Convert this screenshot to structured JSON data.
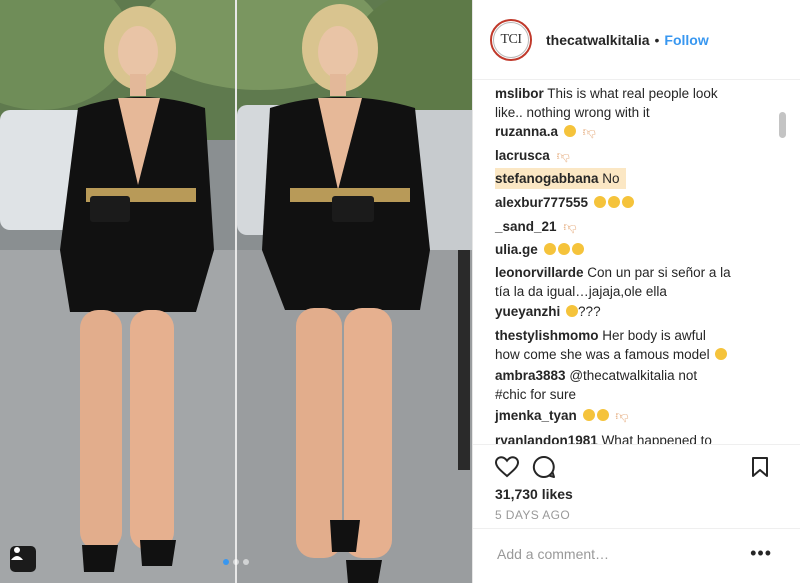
{
  "post": {
    "account_logo_text": "TCI",
    "username": "thecatwalkitalia",
    "separator": "•",
    "follow_label": "Follow",
    "likes": "31,730 likes",
    "time_ago": "5 DAYS AGO",
    "add_comment_placeholder": "Add a comment…",
    "more_label": "•••",
    "carousel": {
      "count": 3,
      "active_index": 0
    }
  },
  "comments": [
    {
      "user": "mslibor",
      "text": "This is what real people look",
      "text2": "like.. nothing wrong with it"
    },
    {
      "user": "ruzanna.a",
      "text": "",
      "emojis": [
        "smile-emoji",
        "thumbs-down-emoji"
      ]
    },
    {
      "user": "lacrusca",
      "text": "",
      "emojis": [
        "thumbs-down-emoji"
      ]
    },
    {
      "user": "stefanogabbana",
      "text": "No",
      "highlighted": true
    },
    {
      "user": "alexbur777555",
      "text": "",
      "emojis": [
        "sad-emoji",
        "sad-emoji",
        "sad-emoji"
      ]
    },
    {
      "user": "_sand_21",
      "text": "",
      "emojis": [
        "thumbs-down-emoji"
      ]
    },
    {
      "user": "ulia.ge",
      "text": "",
      "emojis": [
        "sad-emoji",
        "sad-emoji",
        "sad-emoji"
      ]
    },
    {
      "user": "leonorvillarde",
      "text": "Con un par si señor a la",
      "text2": "tía la da igual…jajaja,ole ella"
    },
    {
      "user": "yueyanzhi",
      "text": "???",
      "emojis_before": [
        "sad-emoji"
      ]
    },
    {
      "user": "thestylishmomo",
      "text": "Her body is awful",
      "text2": "how come she was a famous model"
    },
    {
      "user": "ambra3883",
      "text": "@thecatwalkitalia not",
      "text2": "#chic for sure"
    },
    {
      "user": "jmenka_tyan",
      "text": "",
      "emojis": [
        "sad-emoji",
        "sad-emoji",
        "thumbs-down-emoji"
      ]
    },
    {
      "user": "ryanlandon1981",
      "text": "What happened to"
    }
  ],
  "colors": {
    "link": "#3897f0",
    "highlight": "#fbe7c4",
    "logo_ring": "#c0392b",
    "text": "#262626",
    "muted": "#999999"
  }
}
